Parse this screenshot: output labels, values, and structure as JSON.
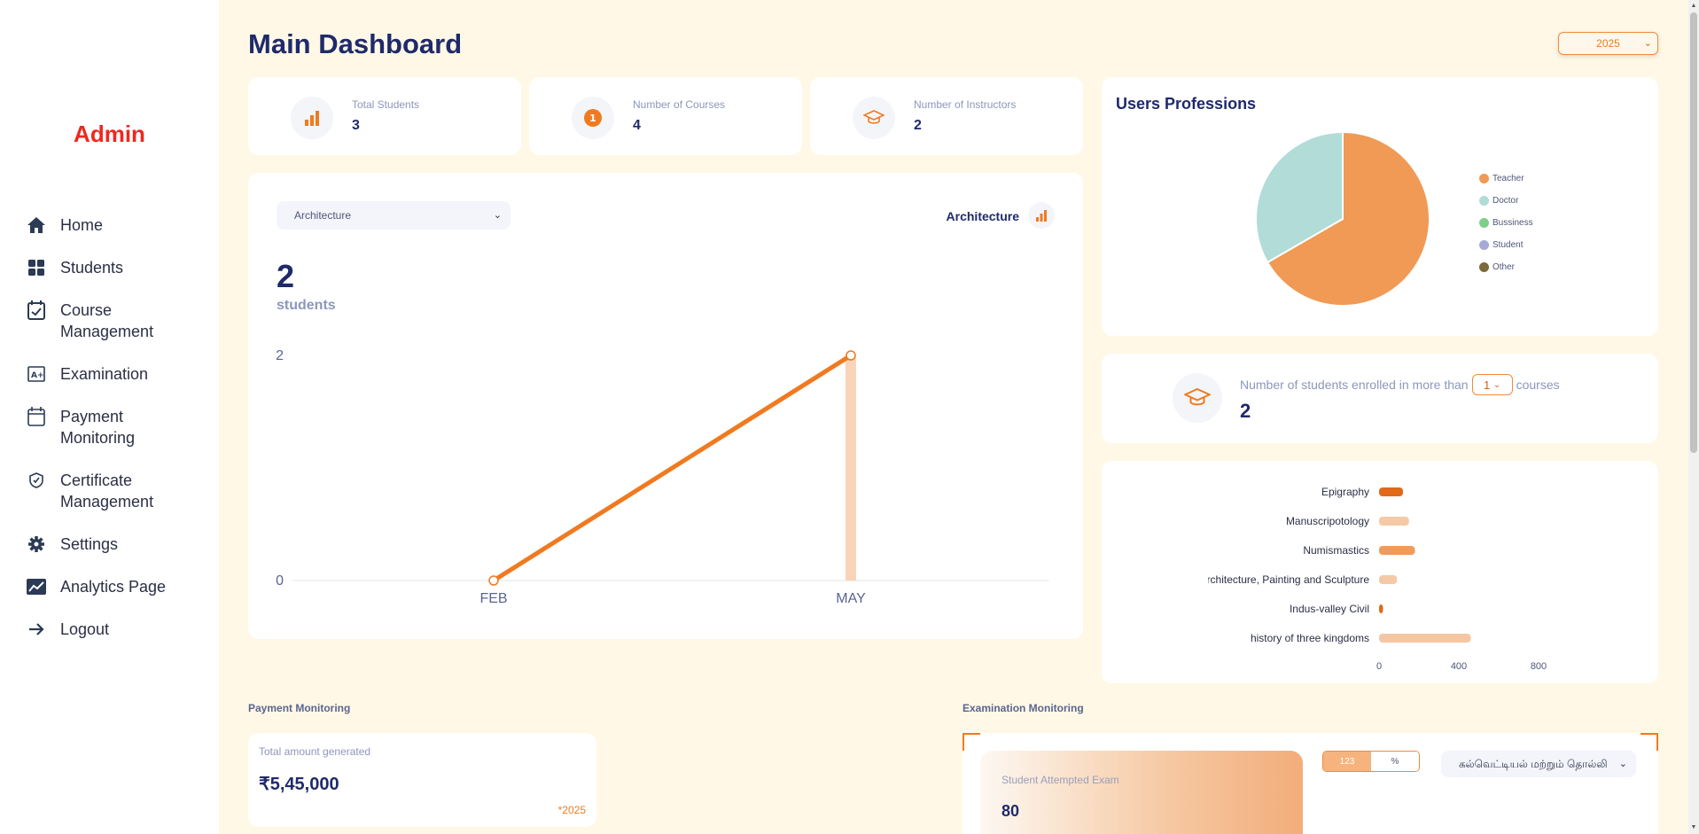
{
  "sidebar": {
    "brand": "Admin",
    "items": [
      {
        "label": "Home",
        "icon": "home-icon"
      },
      {
        "label": "Students",
        "icon": "grid-icon"
      },
      {
        "label": "Course Management",
        "icon": "calendar-check-icon"
      },
      {
        "label": "Examination",
        "icon": "grade-board-icon"
      },
      {
        "label": "Payment Monitoring",
        "icon": "calendar-payment-icon"
      },
      {
        "label": "Certificate Management",
        "icon": "shield-check-icon"
      },
      {
        "label": "Settings",
        "icon": "gear-icon"
      },
      {
        "label": "Analytics Page",
        "icon": "chart-line-icon"
      },
      {
        "label": "Logout",
        "icon": "arrow-right-icon"
      }
    ]
  },
  "header": {
    "title": "Main Dashboard",
    "year": "2025"
  },
  "stats": [
    {
      "label": "Total Students",
      "value": "3",
      "icon": "bar-chart-icon"
    },
    {
      "label": "Number of Courses",
      "value": "4",
      "icon": "number-one-icon"
    },
    {
      "label": "Number of Instructors",
      "value": "2",
      "icon": "graduation-cap-icon"
    }
  ],
  "course_chart": {
    "selected_course": "Architecture",
    "course_title": "Architecture",
    "count": "2",
    "count_label": "students"
  },
  "professions": {
    "title": "Users Professions",
    "legend": [
      {
        "label": "Teacher",
        "color": "#f09a55"
      },
      {
        "label": "Doctor",
        "color": "#b1dcd8"
      },
      {
        "label": "Bussiness",
        "color": "#7fcf8a"
      },
      {
        "label": "Student",
        "color": "#a6a8d6"
      },
      {
        "label": "Other",
        "color": "#7a6a3c"
      }
    ]
  },
  "enrollment": {
    "text_before": "Number of students enrolled in more than",
    "selected": "1",
    "text_after": "courses",
    "value": "2"
  },
  "payment": {
    "section_label": "Payment Monitoring",
    "total_label": "Total amount generated",
    "total_value": "₹5,45,000",
    "year_note": "*2025"
  },
  "exam": {
    "section_label": "Examination Monitoring",
    "attempted_label": "Student Attempted Exam",
    "attempted_value": "80",
    "toggle_count": "123",
    "toggle_percent": "%",
    "course_select": "கல்வெட்டியல் மற்றும் தொல்லி"
  },
  "chart_data": [
    {
      "type": "line",
      "categories": [
        "FEB",
        "MAY"
      ],
      "values": [
        0,
        2
      ],
      "ylim": [
        0,
        2
      ],
      "yticks": [
        "0",
        "2"
      ],
      "highlight_category": "MAY"
    },
    {
      "type": "pie",
      "labels": [
        "Teacher",
        "Doctor",
        "Bussiness",
        "Student",
        "Other"
      ],
      "values": [
        2,
        1,
        0,
        0,
        0
      ],
      "colors": [
        "#f09a55",
        "#b1dcd8",
        "#7fcf8a",
        "#a6a8d6",
        "#7a6a3c"
      ]
    },
    {
      "type": "bar",
      "orientation": "horizontal",
      "categories": [
        "Epigraphy",
        "Manuscripotology",
        "Numismastics",
        "Architecture, Painting and Sculpture",
        "Indus-valley Civil",
        "history of three kingdoms"
      ],
      "values": [
        120,
        150,
        180,
        90,
        20,
        460
      ],
      "colors": [
        "#e0691a",
        "#f6c9a6",
        "#f29a5a",
        "#f6c9a6",
        "#e0691a",
        "#f4c7a2"
      ],
      "xticks": [
        "0",
        "400",
        "800"
      ],
      "xlim": [
        0,
        800
      ]
    }
  ]
}
